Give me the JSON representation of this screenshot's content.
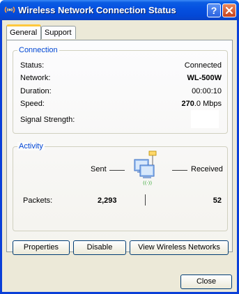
{
  "window": {
    "title": "Wireless Network Connection Status"
  },
  "tabs": [
    {
      "label": "General",
      "active": true
    },
    {
      "label": "Support",
      "active": false
    }
  ],
  "connection": {
    "legend": "Connection",
    "status_label": "Status:",
    "status_value": "Connected",
    "network_label": "Network:",
    "network_value": "WL-500W",
    "duration_label": "Duration:",
    "duration_value": "00:00:10",
    "speed_label": "Speed:",
    "speed_value_bold": "270",
    "speed_value_rest": ".0 Mbps",
    "signal_label": "Signal Strength:"
  },
  "activity": {
    "legend": "Activity",
    "sent_label": "Sent",
    "received_label": "Received",
    "packets_label": "Packets:",
    "packets_sent": "2,293",
    "packets_received": "52"
  },
  "buttons": {
    "properties": "Properties",
    "disable": "Disable",
    "view_networks": "View Wireless Networks",
    "close": "Close"
  },
  "titlebar_buttons": {
    "help": "?"
  },
  "colors": {
    "title_bar": "#0551e0",
    "legend_text": "#0046d5",
    "face": "#ece9d8",
    "tab_highlight": "#ffc83c"
  }
}
